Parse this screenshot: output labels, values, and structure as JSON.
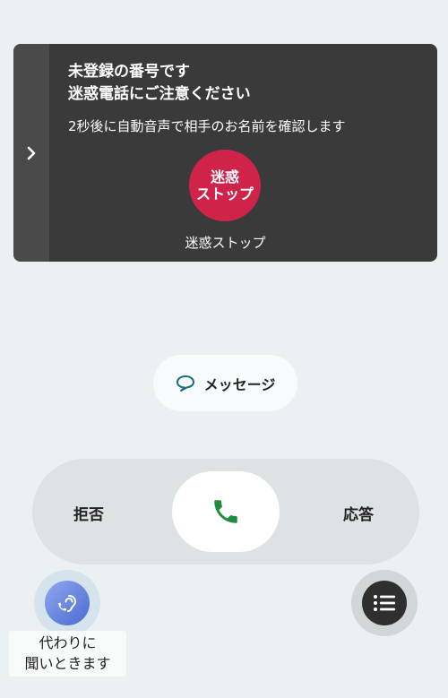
{
  "card": {
    "title": "未登録の番号です\n迷惑電話にご注意ください",
    "subtitle": "2秒後に自動音声で相手のお名前を確認します",
    "stop_button": "迷惑\nストップ",
    "stop_label": "迷惑ストップ",
    "expand_icon": "chevron-right-icon"
  },
  "message_button": {
    "label": "メッセージ",
    "icon": "speech-bubble-icon"
  },
  "call": {
    "decline_label": "拒否",
    "answer_label": "応答",
    "phone_icon": "phone-icon",
    "phone_color": "#1e8e3e"
  },
  "listen": {
    "label": "代わりに\n聞いときます",
    "icon": "ear-phone-icon"
  },
  "menu": {
    "icon": "list-icon"
  },
  "colors": {
    "stop": "#d0234a",
    "card": "#3a3a3a",
    "background": "#ebf1f2"
  }
}
